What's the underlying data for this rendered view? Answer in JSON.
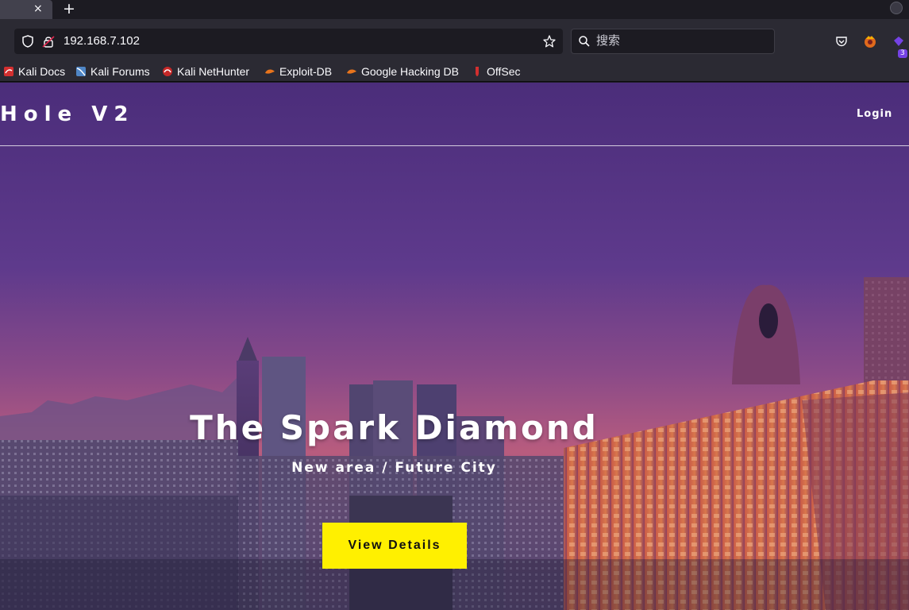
{
  "browser": {
    "tab": {
      "close_glyph": "×"
    },
    "new_tab_glyph": "+",
    "url": "192.168.7.102",
    "search_placeholder": "搜索",
    "extension_badge": "3",
    "bookmarks": [
      {
        "label": "Kali Docs",
        "icon": "kali-docs-icon"
      },
      {
        "label": "Kali Forums",
        "icon": "kali-forums-icon"
      },
      {
        "label": "Kali NetHunter",
        "icon": "kali-nethunter-icon"
      },
      {
        "label": "Exploit-DB",
        "icon": "exploit-db-icon"
      },
      {
        "label": "Google Hacking DB",
        "icon": "ghdb-icon"
      },
      {
        "label": "OffSec",
        "icon": "offsec-icon"
      }
    ]
  },
  "site": {
    "brand": "Hole V2",
    "nav_login": "Login",
    "hero_title": "The Spark Diamond",
    "hero_subtitle": "New area / Future City",
    "cta_label": "View Details"
  },
  "colors": {
    "cta_bg": "#fff000",
    "sky_top": "#4a2c78",
    "sky_horizon": "#b45a7d"
  }
}
